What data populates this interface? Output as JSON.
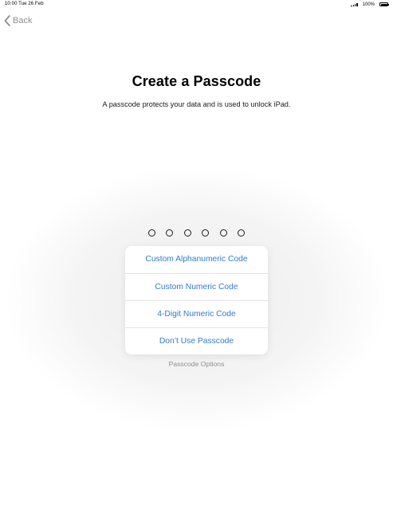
{
  "status_bar": {
    "time_date": "10:00  Tue 26 Feb",
    "battery": "100%"
  },
  "nav": {
    "back_label": "Back"
  },
  "header": {
    "title": "Create a Passcode",
    "subtitle": "A passcode protects your data and is used to unlock iPad."
  },
  "passcode": {
    "digit_count": 6
  },
  "options_menu": {
    "items": [
      {
        "label": "Custom Alphanumeric Code"
      },
      {
        "label": "Custom Numeric Code"
      },
      {
        "label": "4-Digit Numeric Code"
      },
      {
        "label": "Don’t Use Passcode"
      }
    ],
    "toggle_label": "Passcode Options"
  },
  "colors": {
    "accent": "#2f7bd0",
    "muted": "#8e8e93"
  },
  "icons": [
    "signal-bars-icon",
    "battery-icon",
    "chevron-left-icon"
  ]
}
